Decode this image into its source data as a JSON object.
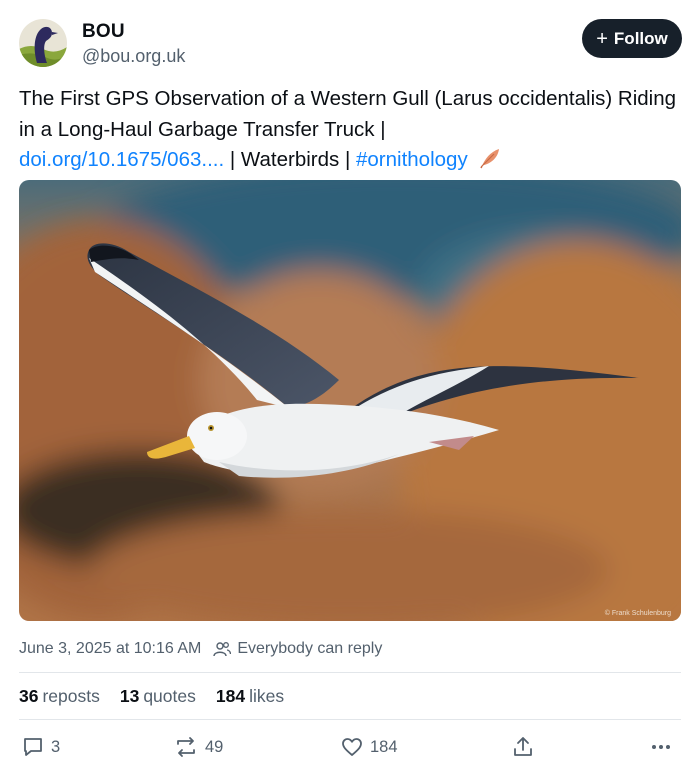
{
  "author": {
    "display_name": "BOU",
    "handle": "@bou.org.uk",
    "avatar_icon": "bou-logo-avatar"
  },
  "follow": {
    "label": "Follow",
    "icon": "plus-icon"
  },
  "post": {
    "text_line1": "The First GPS Observation of a Western Gull (Larus occidentalis) Riding in a Long-Haul Garbage Transfer Truck",
    "separator": "|",
    "link_doi": "doi.org/10.1675/063....",
    "journal": "Waterbirds",
    "hashtag": "#ornithology",
    "emoji_icon": "feather-leaf-icon"
  },
  "image": {
    "credit": "© Frank Schulenburg"
  },
  "meta": {
    "timestamp": "June 3, 2025 at 10:16 AM",
    "reply_setting": "Everybody can reply"
  },
  "stats": {
    "reposts_count": "36",
    "reposts_label": "reposts",
    "quotes_count": "13",
    "quotes_label": "quotes",
    "likes_count": "184",
    "likes_label": "likes"
  },
  "actions": {
    "replies": "3",
    "reposts": "49",
    "likes": "184"
  },
  "colors": {
    "link": "#1083fe",
    "follow_bg": "#17202a",
    "muted": "#53606d"
  }
}
